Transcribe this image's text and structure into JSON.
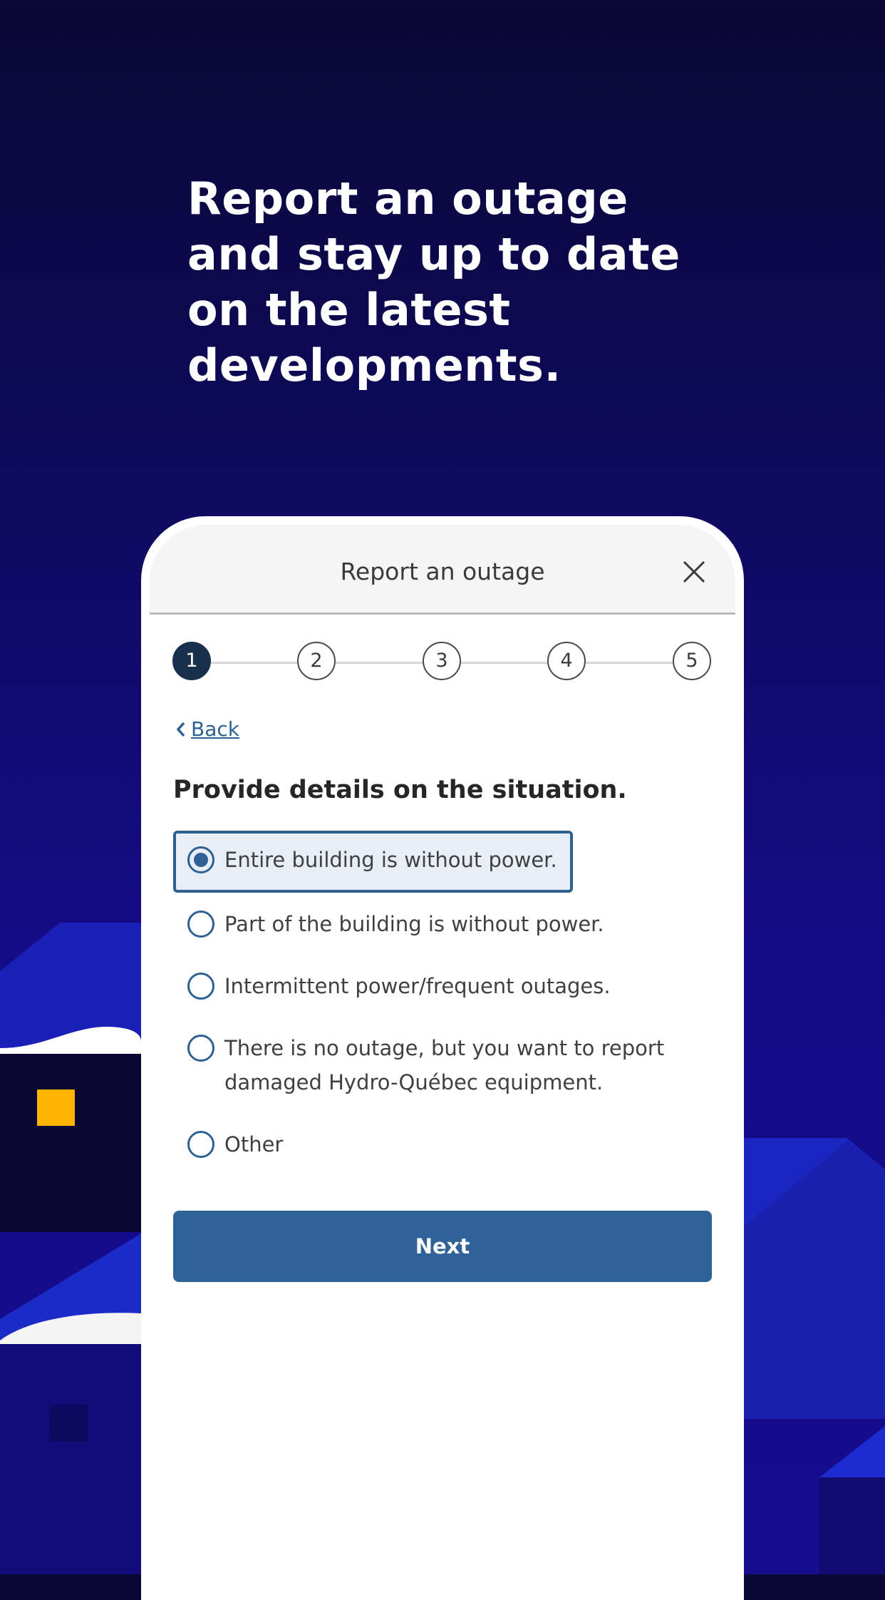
{
  "headline": "Report an outage and stay up to date on the latest developments.",
  "modal": {
    "title": "Report an outage",
    "close_icon": "close-icon"
  },
  "stepper": {
    "steps": [
      "1",
      "2",
      "3",
      "4",
      "5"
    ],
    "current": 1
  },
  "back_label": "Back",
  "question": "Provide details on the situation.",
  "options": [
    {
      "label": "Entire building is without power.",
      "selected": true
    },
    {
      "label": "Part of the building is without power.",
      "selected": false
    },
    {
      "label": "Intermittent power/frequent outages.",
      "selected": false
    },
    {
      "label": "There is no outage, but you want to report damaged Hydro-Québec equipment.",
      "selected": false
    },
    {
      "label": "Other",
      "selected": false
    }
  ],
  "next_label": "Next",
  "colors": {
    "accent": "#2d6193",
    "active_step": "#19304d",
    "background": "#0e0a5c",
    "window_light": "#ffb400"
  }
}
